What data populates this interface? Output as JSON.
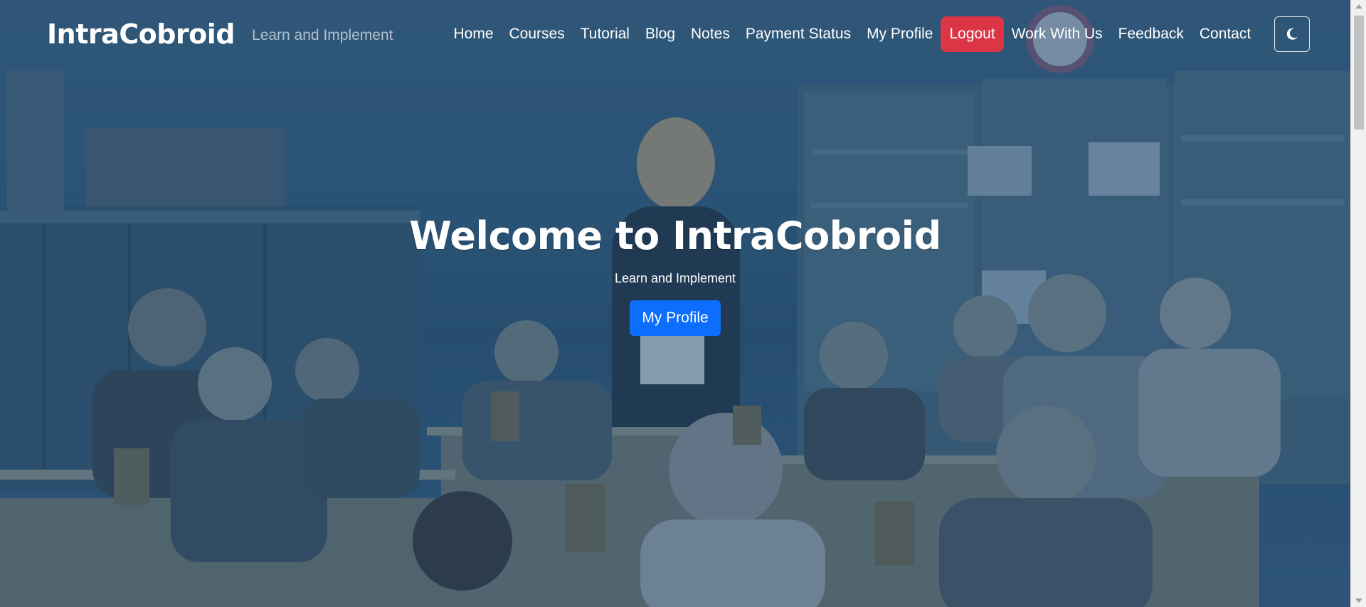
{
  "navbar": {
    "brand": "IntraCobroid",
    "tagline": "Learn and Implement",
    "links": [
      {
        "label": "Home"
      },
      {
        "label": "Courses"
      },
      {
        "label": "Tutorial"
      },
      {
        "label": "Blog"
      },
      {
        "label": "Notes"
      },
      {
        "label": "Payment Status"
      },
      {
        "label": "My Profile"
      },
      {
        "label": "Logout"
      },
      {
        "label": "Work With Us"
      },
      {
        "label": "Feedback"
      },
      {
        "label": "Contact"
      }
    ],
    "theme_toggle_icon": "moon-icon"
  },
  "hero": {
    "title": "Welcome to IntraCobroid",
    "subtitle": "Learn and Implement",
    "button_label": "My Profile",
    "background": "classroom-photo"
  },
  "colors": {
    "logout_bg": "#dc3545",
    "primary_button": "#0d6efd",
    "overlay": "#163c64"
  }
}
